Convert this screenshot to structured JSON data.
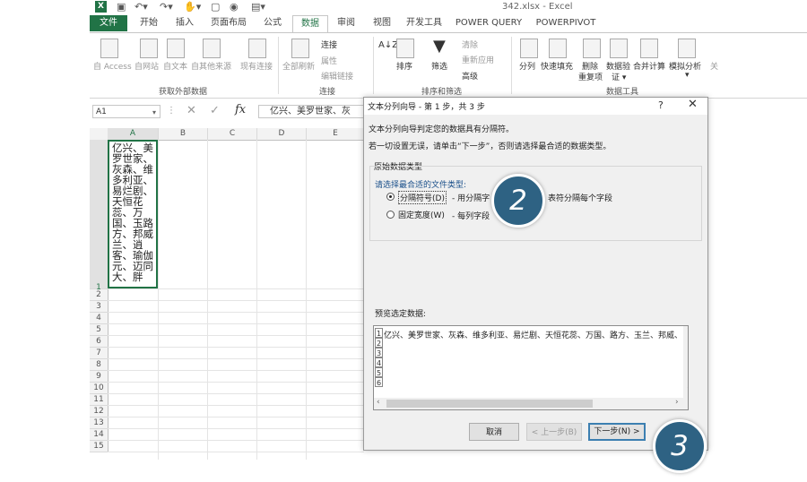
{
  "window": {
    "title": "342.xlsx - Excel"
  },
  "tabs": {
    "file": "文件",
    "home": "开始",
    "insert": "插入",
    "layout": "页面布局",
    "formula": "公式",
    "data": "数据",
    "review": "审阅",
    "view": "视图",
    "dev": "开发工具",
    "pq": "POWER QUERY",
    "pp": "POWERPIVOT"
  },
  "ribbon": {
    "access": "自 Access",
    "web": "自网站",
    "text": "自文本",
    "other": "自其他来源",
    "existing": "现有连接",
    "refresh": "全部刷新",
    "connections": "连接",
    "properties": "属性",
    "edit_links": "编辑链接",
    "filter": "筛选",
    "clear": "清除",
    "reapply": "重新应用",
    "advanced": "高级",
    "sort": "排序",
    "split": "分列",
    "flash": "快速填充",
    "remove_dup": "删除",
    "remove_dup2": "重复项",
    "validate": "数据验",
    "validate2": "证 ▾",
    "consolidate": "合并计算",
    "whatif": "模拟分析",
    "whatif2": "▾",
    "more": "关",
    "group_ext": "获取外部数据",
    "group_conn": "连接",
    "group_sort": "排序和筛选",
    "group_tools": "数据工具"
  },
  "formula_bar": {
    "name_box": "A1",
    "fx": "fx",
    "content": "亿兴、美罗世家、灰"
  },
  "grid": {
    "columns": [
      "A",
      "B",
      "C",
      "D",
      "E"
    ],
    "rows": [
      "1",
      "2",
      "3",
      "4",
      "5",
      "6",
      "7",
      "8",
      "9",
      "10",
      "11",
      "12",
      "13",
      "14",
      "15"
    ],
    "a1": "亿兴、美罗世家、灰森、维多利亚、易烂剧、天恒花蕊、万国、玉路方、邦威兰、逍客、瑜伽元、迈同大、胖"
  },
  "dialog": {
    "title": "文本分列向导 - 第 1 步，共 3 步",
    "help": "?",
    "close": "✕",
    "line1": "文本分列向导判定您的数据具有分隔符。",
    "line2": "若一切设置无误，请单击“下一步”，否则请选择最合适的数据类型。",
    "section": "原始数据类型",
    "choose": "请选择最合适的文件类型:",
    "opt1": "分隔符号(D)",
    "opt1_desc": "- 用分隔字",
    "opt1_desc2": "表符分隔每个字段",
    "opt2": "固定宽度(W)",
    "opt2_desc": "- 每列字段",
    "preview_label": "预览选定数据:",
    "preview_rows": [
      "1",
      "2",
      "3",
      "4",
      "5",
      "6"
    ],
    "preview_text": "亿兴、美罗世家、灰森、维多利亚、易烂剧、天恒花蕊、万国、路方、玉兰、邦威、",
    "btn_cancel": "取消",
    "btn_prev": "< 上一步(B)",
    "btn_next": "下一步(N) >"
  },
  "badges": {
    "step2": "2",
    "step3": "3"
  },
  "colors": {
    "excel_green": "#217346",
    "badge": "#2e6283"
  }
}
